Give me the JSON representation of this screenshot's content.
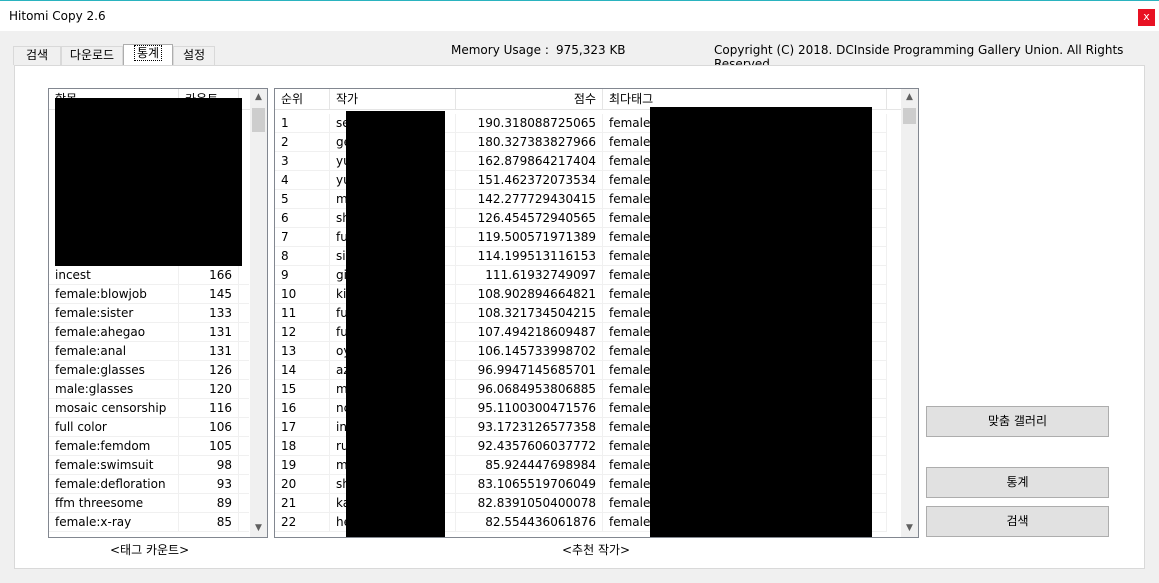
{
  "window": {
    "title": "Hitomi Copy 2.6",
    "close_glyph": "x"
  },
  "tabs": [
    {
      "label": "검색"
    },
    {
      "label": "다운로드"
    },
    {
      "label": "통계",
      "active": true
    },
    {
      "label": "설정"
    }
  ],
  "memory": {
    "label": "Memory Usage :",
    "value": "975,323 KB"
  },
  "copyright": "Copyright (C) 2018. DCInside Programming Gallery Union. All Rights Reserved.",
  "tag_list": {
    "headers": [
      "항목",
      "카운트"
    ],
    "rows": [
      {
        "tag": "incest",
        "count": "166"
      },
      {
        "tag": "female:blowjob",
        "count": "145"
      },
      {
        "tag": "female:sister",
        "count": "133"
      },
      {
        "tag": "female:ahegao",
        "count": "131"
      },
      {
        "tag": "female:anal",
        "count": "131"
      },
      {
        "tag": "female:glasses",
        "count": "126"
      },
      {
        "tag": "male:glasses",
        "count": "120"
      },
      {
        "tag": "mosaic censorship",
        "count": "116"
      },
      {
        "tag": "full color",
        "count": "106"
      },
      {
        "tag": "female:femdom",
        "count": "105"
      },
      {
        "tag": "female:swimsuit",
        "count": "98"
      },
      {
        "tag": "female:defloration",
        "count": "93"
      },
      {
        "tag": "ffm threesome",
        "count": "89"
      },
      {
        "tag": "female:x-ray",
        "count": "85"
      }
    ],
    "caption": "<태그 카운트>"
  },
  "artist_list": {
    "headers": [
      "순위",
      "작가",
      "점수",
      "최다태그"
    ],
    "rows": [
      {
        "rank": "1",
        "artist": "se",
        "score": "190.318088725065",
        "tag": "female:"
      },
      {
        "rank": "2",
        "artist": "ge",
        "score": "180.327383827966",
        "tag": "female:"
      },
      {
        "rank": "3",
        "artist": "yu",
        "score": "162.879864217404",
        "tag": "female:"
      },
      {
        "rank": "4",
        "artist": "yu",
        "score": "151.462372073534",
        "tag": "female:"
      },
      {
        "rank": "5",
        "artist": "m",
        "score": "142.277729430415",
        "tag": "female:"
      },
      {
        "rank": "6",
        "artist": "sh",
        "score": "126.454572940565",
        "tag": "female:"
      },
      {
        "rank": "7",
        "artist": "fu",
        "score": "119.500571971389",
        "tag": "female:"
      },
      {
        "rank": "8",
        "artist": "si",
        "score": "114.199513116153",
        "tag": "female:"
      },
      {
        "rank": "9",
        "artist": "gi",
        "score": "111.61932749097",
        "tag": "female:"
      },
      {
        "rank": "10",
        "artist": "ki",
        "score": "108.902894664821",
        "tag": "female:"
      },
      {
        "rank": "11",
        "artist": "fu",
        "score": "108.321734504215",
        "tag": "female:"
      },
      {
        "rank": "12",
        "artist": "fu",
        "score": "107.494218609487",
        "tag": "female:"
      },
      {
        "rank": "13",
        "artist": "oy",
        "score": "106.145733998702",
        "tag": "female:"
      },
      {
        "rank": "14",
        "artist": "az",
        "score": "96.9947145685701",
        "tag": "female:"
      },
      {
        "rank": "15",
        "artist": "m",
        "score": "96.0684953806885",
        "tag": "female:"
      },
      {
        "rank": "16",
        "artist": "nc",
        "score": "95.1100300471576",
        "tag": "female:"
      },
      {
        "rank": "17",
        "artist": "in",
        "score": "93.1723126577358",
        "tag": "female:"
      },
      {
        "rank": "18",
        "artist": "ru",
        "score": "92.4357606037772",
        "tag": "female:"
      },
      {
        "rank": "19",
        "artist": "m",
        "score": "85.924447698984",
        "tag": "female:"
      },
      {
        "rank": "20",
        "artist": "sh",
        "score": "83.1065519706049",
        "tag": "female:"
      },
      {
        "rank": "21",
        "artist": "ka",
        "score": "82.8391050400078",
        "tag": "female:"
      },
      {
        "rank": "22",
        "artist": "he",
        "score": "82.554436061876",
        "tag": "female:"
      }
    ],
    "caption": "<추천 작가>"
  },
  "buttons": {
    "match_gallery": "맞춤 갤러리",
    "stats": "통계",
    "search": "검색"
  },
  "colors": {
    "accent": "#2ab3bf",
    "close": "#e81123",
    "redaction": "#000000"
  }
}
